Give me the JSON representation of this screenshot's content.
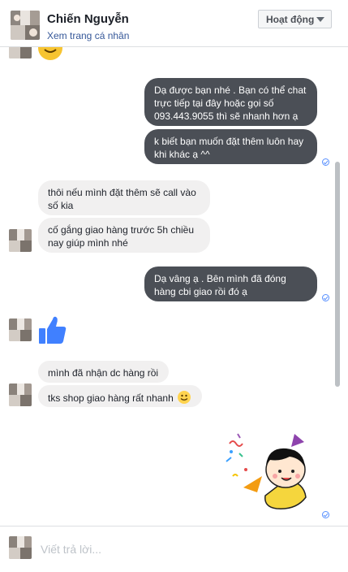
{
  "header": {
    "name": "Chiến Nguyễn",
    "profile_link": "Xem trang cá nhân",
    "status": "Hoạt động"
  },
  "messages": [
    {
      "side": "out",
      "text": "Dạ được bạn nhé . Bạn có thể chat trực tiếp tại đây hoặc gọi số 093.443.9055  thì sẽ nhanh hơn ạ"
    },
    {
      "side": "out",
      "text": "k biết bạn muốn đặt thêm luôn hay khi khác ạ ^^"
    },
    {
      "side": "in",
      "text": "thôi nếu mình đặt thêm sẽ call vào số kia"
    },
    {
      "side": "in",
      "text": "cố gắng giao hàng trước 5h chiều nay giúp mình nhé"
    },
    {
      "side": "out",
      "text": "Dạ vâng ạ . Bên mình đã đóng hàng cbi giao rồi đó ạ"
    },
    {
      "side": "in",
      "type": "like",
      "icon": "thumbs-up-icon"
    },
    {
      "side": "in",
      "text": "mình đã nhận dc hàng rồi"
    },
    {
      "side": "in",
      "text": "tks shop giao hàng rất nhanh",
      "icon": "smile-emoji-icon"
    },
    {
      "side": "out",
      "type": "sticker",
      "icon": "celebration-sticker-icon"
    }
  ],
  "composer": {
    "placeholder": "Viết trả lời..."
  },
  "colors": {
    "outgoing_bubble": "#4b4f56",
    "incoming_bubble": "#f1f0f0",
    "link": "#365899",
    "like": "#4080ff",
    "seen": "#5890ff"
  }
}
